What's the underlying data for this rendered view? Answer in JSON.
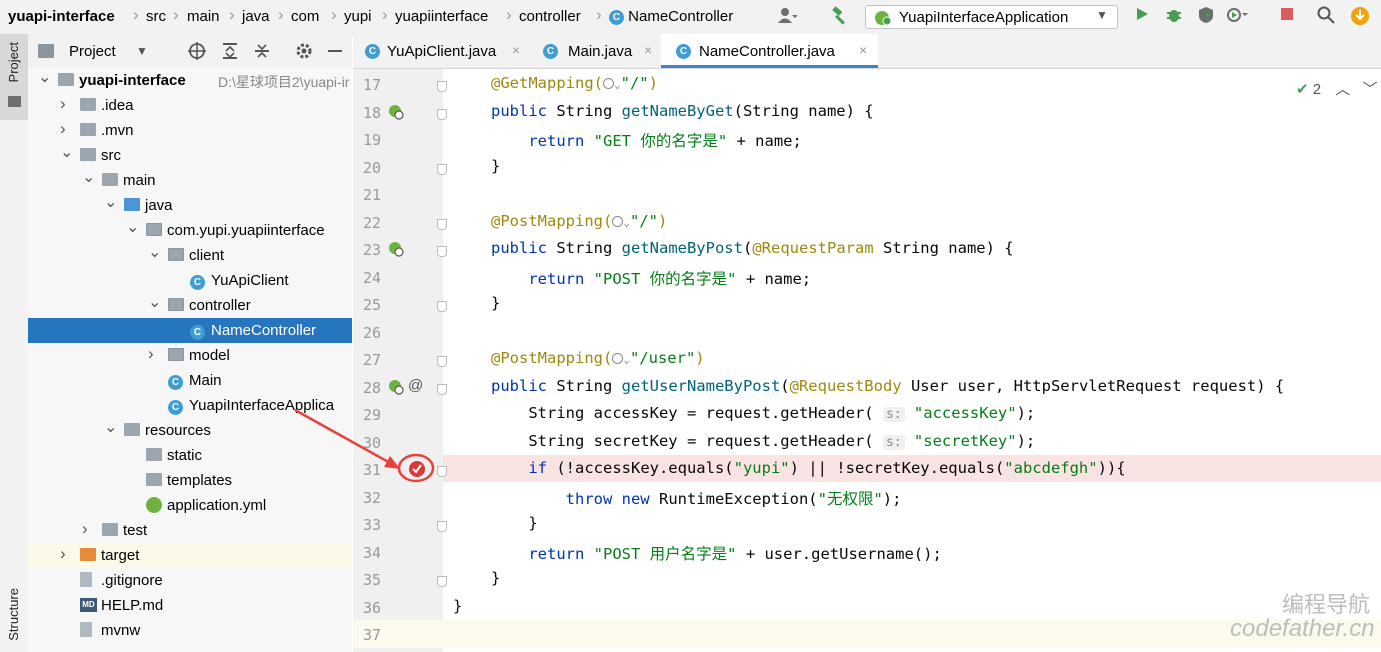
{
  "breadcrumb": [
    "yuapi-interface",
    "src",
    "main",
    "java",
    "com",
    "yupi",
    "yuapiinterface",
    "controller",
    "NameController"
  ],
  "toolbar": {
    "run_config": "YuapiInterfaceApplication",
    "icons": [
      "user-icon",
      "build-hammer-icon",
      "run-icon",
      "debug-icon",
      "coverage-icon",
      "profile-icon",
      "stop-icon",
      "search-icon",
      "update-icon"
    ]
  },
  "left_strip": {
    "project_label": "Project",
    "structure_label": "Structure"
  },
  "project_panel": {
    "title": "Project",
    "tree": [
      {
        "label": "yuapi-interface",
        "path": "D:\\星球项目2\\yuapi-ir",
        "depth": 0,
        "expanded": true,
        "kind": "module"
      },
      {
        "label": ".idea",
        "depth": 1,
        "expanded": false,
        "kind": "folder"
      },
      {
        "label": ".mvn",
        "depth": 1,
        "expanded": false,
        "kind": "folder"
      },
      {
        "label": "src",
        "depth": 1,
        "expanded": true,
        "kind": "folder"
      },
      {
        "label": "main",
        "depth": 2,
        "expanded": true,
        "kind": "folder"
      },
      {
        "label": "java",
        "depth": 3,
        "expanded": true,
        "kind": "folder-blue"
      },
      {
        "label": "com.yupi.yuapiinterface",
        "depth": 4,
        "expanded": true,
        "kind": "package"
      },
      {
        "label": "client",
        "depth": 5,
        "expanded": true,
        "kind": "package"
      },
      {
        "label": "YuApiClient",
        "depth": 6,
        "kind": "class"
      },
      {
        "label": "controller",
        "depth": 5,
        "expanded": true,
        "kind": "package"
      },
      {
        "label": "NameController",
        "depth": 6,
        "kind": "class",
        "selected": true
      },
      {
        "label": "model",
        "depth": 5,
        "expanded": false,
        "kind": "package"
      },
      {
        "label": "Main",
        "depth": 5,
        "kind": "class-run"
      },
      {
        "label": "YuapiInterfaceApplica",
        "depth": 5,
        "kind": "class-run"
      },
      {
        "label": "resources",
        "depth": 3,
        "expanded": true,
        "kind": "folder"
      },
      {
        "label": "static",
        "depth": 4,
        "kind": "folder"
      },
      {
        "label": "templates",
        "depth": 4,
        "kind": "folder"
      },
      {
        "label": "application.yml",
        "depth": 4,
        "kind": "yml"
      },
      {
        "label": "test",
        "depth": 2,
        "expanded": false,
        "kind": "folder"
      },
      {
        "label": "target",
        "depth": 1,
        "expanded": false,
        "kind": "folder-orange",
        "highlight": true
      },
      {
        "label": ".gitignore",
        "depth": 1,
        "kind": "file"
      },
      {
        "label": "HELP.md",
        "depth": 1,
        "kind": "md"
      },
      {
        "label": "mvnw",
        "depth": 1,
        "kind": "file"
      }
    ]
  },
  "tabs": [
    {
      "label": "YuApiClient.java",
      "active": false
    },
    {
      "label": "Main.java",
      "active": false
    },
    {
      "label": "NameController.java",
      "active": true
    }
  ],
  "editor": {
    "inspection_count": "2",
    "lines": [
      {
        "n": "17",
        "segs": [
          [
            "ann",
            "@GetMapping("
          ],
          [
            "globe",
            ""
          ],
          [
            "str",
            "\"/\""
          ],
          [
            "ann",
            ")"
          ]
        ]
      },
      {
        "n": "18",
        "segs": [
          [
            "kw",
            "public "
          ],
          [
            "plain",
            "String "
          ],
          [
            "fn",
            "getNameByGet"
          ],
          [
            "plain",
            "(String name) {"
          ]
        ],
        "gutter": "web"
      },
      {
        "n": "19",
        "segs": [
          [
            "plain",
            "    "
          ],
          [
            "kw",
            "return "
          ],
          [
            "str",
            "\"GET 你的名字是\""
          ],
          [
            "plain",
            " + name;"
          ]
        ]
      },
      {
        "n": "20",
        "segs": [
          [
            "plain",
            "}"
          ]
        ]
      },
      {
        "n": "21",
        "segs": []
      },
      {
        "n": "22",
        "segs": [
          [
            "ann",
            "@PostMapping("
          ],
          [
            "globe",
            ""
          ],
          [
            "str",
            "\"/\""
          ],
          [
            "ann",
            ")"
          ]
        ]
      },
      {
        "n": "23",
        "segs": [
          [
            "kw",
            "public "
          ],
          [
            "plain",
            "String "
          ],
          [
            "fn",
            "getNameByPost"
          ],
          [
            "plain",
            "("
          ],
          [
            "ann",
            "@RequestParam "
          ],
          [
            "plain",
            "String name) {"
          ]
        ],
        "gutter": "web"
      },
      {
        "n": "24",
        "segs": [
          [
            "plain",
            "    "
          ],
          [
            "kw",
            "return "
          ],
          [
            "str",
            "\"POST 你的名字是\""
          ],
          [
            "plain",
            " + name;"
          ]
        ]
      },
      {
        "n": "25",
        "segs": [
          [
            "plain",
            "}"
          ]
        ]
      },
      {
        "n": "26",
        "segs": []
      },
      {
        "n": "27",
        "segs": [
          [
            "ann",
            "@PostMapping("
          ],
          [
            "globe",
            ""
          ],
          [
            "str",
            "\"/user\""
          ],
          [
            "ann",
            ")"
          ]
        ]
      },
      {
        "n": "28",
        "segs": [
          [
            "kw",
            "public "
          ],
          [
            "plain",
            "String "
          ],
          [
            "fn",
            "getUserNameByPost"
          ],
          [
            "plain",
            "("
          ],
          [
            "ann",
            "@RequestBody "
          ],
          [
            "plain",
            "User user, HttpServletRequest request) {"
          ]
        ],
        "gutter": "web-at"
      },
      {
        "n": "29",
        "segs": [
          [
            "plain",
            "    String accessKey = request.getHeader( "
          ],
          [
            "hint",
            "s:"
          ],
          [
            "str",
            " \"accessKey\""
          ],
          [
            "plain",
            ");"
          ]
        ]
      },
      {
        "n": "30",
        "segs": [
          [
            "plain",
            "    String secretKey = request.getHeader( "
          ],
          [
            "hint",
            "s:"
          ],
          [
            "str",
            " \"secretKey\""
          ],
          [
            "plain",
            ");"
          ]
        ]
      },
      {
        "n": "31",
        "segs": [
          [
            "plain",
            "    "
          ],
          [
            "kw",
            "if "
          ],
          [
            "plain",
            "(!accessKey.equals("
          ],
          [
            "str",
            "\"yupi\""
          ],
          [
            "plain",
            ") || !secretKey.equals("
          ],
          [
            "str",
            "\"abcdefgh\""
          ],
          [
            "plain",
            "))"
          ],
          [
            "plain",
            "{"
          ]
        ],
        "gutter": "breakpoint"
      },
      {
        "n": "32",
        "segs": [
          [
            "plain",
            "        "
          ],
          [
            "kw",
            "throw new "
          ],
          [
            "plain",
            "RuntimeException("
          ],
          [
            "str",
            "\"无权限\""
          ],
          [
            "plain",
            ");"
          ]
        ]
      },
      {
        "n": "33",
        "segs": [
          [
            "plain",
            "    }"
          ]
        ]
      },
      {
        "n": "34",
        "segs": [
          [
            "plain",
            "    "
          ],
          [
            "kw",
            "return "
          ],
          [
            "str",
            "\"POST 用户名字是\""
          ],
          [
            "plain",
            " + user.getUsername();"
          ]
        ]
      },
      {
        "n": "35",
        "segs": [
          [
            "plain",
            "}"
          ]
        ]
      },
      {
        "n": "36",
        "segs": [
          [
            "plain",
            "}"
          ]
        ]
      },
      {
        "n": "37",
        "segs": []
      }
    ]
  },
  "watermark": {
    "line1": "编程导航",
    "line2": "codefather.cn"
  },
  "colors": {
    "selection": "#2675bf",
    "breakpoint": "#d9383a",
    "annotation": "#9e880d",
    "keyword": "#0033b3",
    "string": "#067d17"
  }
}
